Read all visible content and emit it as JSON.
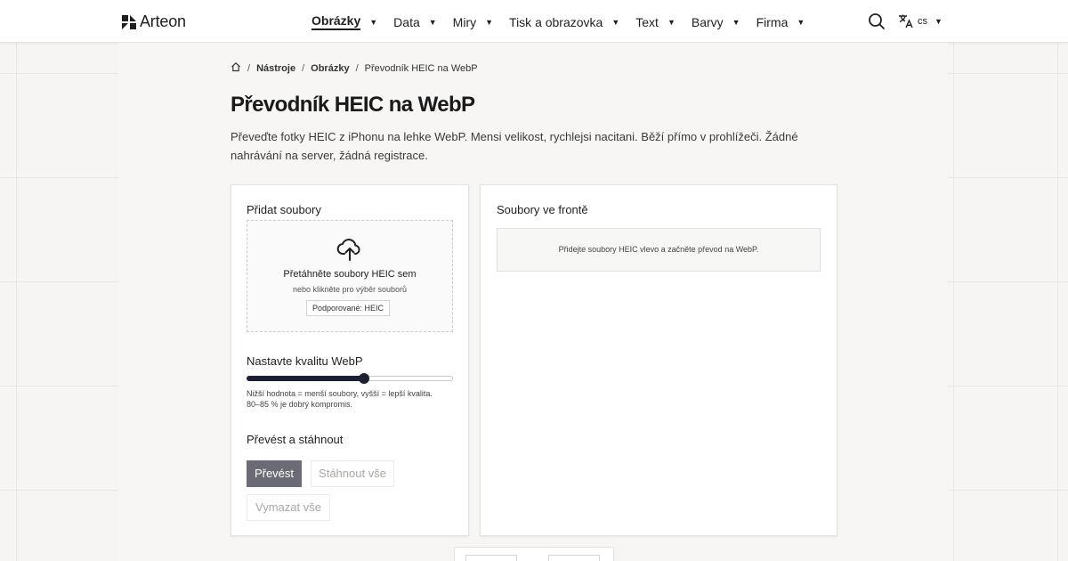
{
  "header": {
    "logo_text": "Arteon",
    "nav": [
      {
        "label": "Obrázky",
        "active": true
      },
      {
        "label": "Data",
        "active": false
      },
      {
        "label": "Miry",
        "active": false
      },
      {
        "label": "Tisk a obrazovka",
        "active": false
      },
      {
        "label": "Text",
        "active": false
      },
      {
        "label": "Barvy",
        "active": false
      },
      {
        "label": "Firma",
        "active": false
      }
    ],
    "search_icon": "search-icon",
    "language": "cs",
    "language_icon": "translate-icon"
  },
  "breadcrumb": {
    "home_icon": "home-icon",
    "items": [
      "Nástroje",
      "Obrázky",
      "Převodník HEIC na WebP"
    ]
  },
  "page": {
    "title": "Převodník HEIC na WebP",
    "description": "Převeďte fotky HEIC z iPhonu na lehke WebP. Mensi velikost, rychlejsi nacitani. Běží přímo v prohlížeči. Žádné nahrávání na server, žádná registrace."
  },
  "upload": {
    "title": "Přidat soubory",
    "icon": "cloud-upload-icon",
    "drop_text": "Přetáhněte soubory HEIC sem",
    "browse_text": "nebo klikněte pro výběr souborů",
    "supported": "Podporované: HEIC"
  },
  "quality": {
    "title": "Nastavte kvalitu WebP",
    "value_fraction": 0.57,
    "hint_line1": "Nižší hodnota = menší soubory, vyšší = lepší kvalita.",
    "hint_line2": "80–85 % je dobrý kompromis."
  },
  "actions": {
    "title": "Převést a stáhnout",
    "convert": "Převést",
    "download_all": "Stáhnout vše",
    "clear_all": "Vymazat vše"
  },
  "queue": {
    "title": "Soubory ve frontě",
    "empty": "Přidejte soubory HEIC vlevo a začněte převod na WebP."
  },
  "colors": {
    "accent": "#1d1f33",
    "primary_button": "#6b6b75",
    "disabled_text": "#a9a7a4"
  }
}
